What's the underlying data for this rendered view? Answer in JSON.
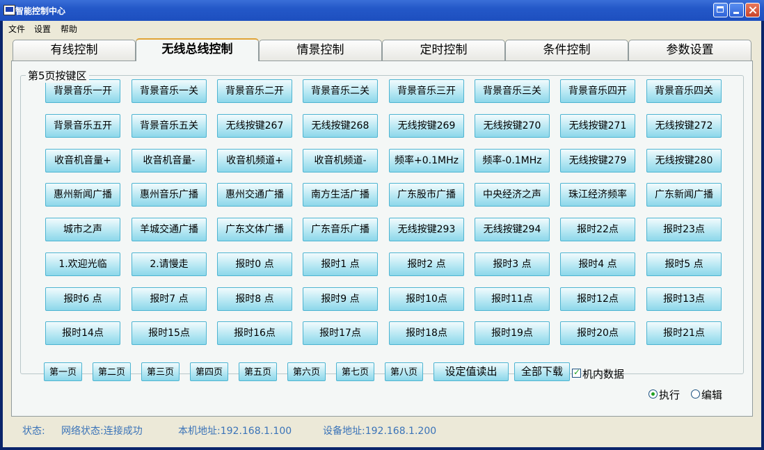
{
  "window": {
    "title": "智能控制中心"
  },
  "menu": [
    "文件",
    "设置",
    "帮助"
  ],
  "tabs": [
    {
      "label": "有线控制",
      "active": false
    },
    {
      "label": "无线总线控制",
      "active": true
    },
    {
      "label": "情景控制",
      "active": false
    },
    {
      "label": "定时控制",
      "active": false
    },
    {
      "label": "条件控制",
      "active": false
    },
    {
      "label": "参数设置",
      "active": false
    }
  ],
  "group": {
    "title": "第5页按键区"
  },
  "keys": [
    [
      "背景音乐一开",
      "背景音乐一关",
      "背景音乐二开",
      "背景音乐二关",
      "背景音乐三开",
      "背景音乐三关",
      "背景音乐四开",
      "背景音乐四关"
    ],
    [
      "背景音乐五开",
      "背景音乐五关",
      "无线按键267",
      "无线按键268",
      "无线按键269",
      "无线按键270",
      "无线按键271",
      "无线按键272"
    ],
    [
      "收音机音量+",
      "收音机音量-",
      "收音机频道+",
      "收音机频道-",
      "频率+0.1MHz",
      "频率-0.1MHz",
      "无线按键279",
      "无线按键280"
    ],
    [
      "惠州新闻广播",
      "惠州音乐广播",
      "惠州交通广播",
      "南方生活广播",
      "广东股市广播",
      "中央经济之声",
      "珠江经济频率",
      "广东新闻广播"
    ],
    [
      "城市之声",
      "羊城交通广播",
      "广东文体广播",
      "广东音乐广播",
      "无线按键293",
      "无线按键294",
      "报时22点",
      "报时23点"
    ],
    [
      "1.欢迎光临",
      "2.请慢走",
      "报时0 点",
      "报时1 点",
      "报时2 点",
      "报时3 点",
      "报时4 点",
      "报时5 点"
    ],
    [
      "报时6 点",
      "报时7 点",
      "报时8 点",
      "报时9 点",
      "报时10点",
      "报时11点",
      "报时12点",
      "报时13点"
    ],
    [
      "报时14点",
      "报时15点",
      "报时16点",
      "报时17点",
      "报时18点",
      "报时19点",
      "报时20点",
      "报时21点"
    ]
  ],
  "pages": [
    "第一页",
    "第二页",
    "第三页",
    "第四页",
    "第五页",
    "第六页",
    "第七页",
    "第八页"
  ],
  "actions": {
    "read": "设定值读出",
    "download": "全部下载"
  },
  "internal_data": {
    "label": "机内数据",
    "checked": true
  },
  "modes": [
    {
      "label": "执行",
      "selected": true
    },
    {
      "label": "编辑",
      "selected": false
    }
  ],
  "status": {
    "label": "状态:",
    "network": "网络状态:连接成功",
    "local_ip": "本机地址:192.168.1.100",
    "device_ip": "设备地址:192.168.1.200"
  },
  "colors": {
    "titlebar": "#2458c8",
    "button": "#b3e6f2",
    "status_text": "#3a73b8"
  }
}
